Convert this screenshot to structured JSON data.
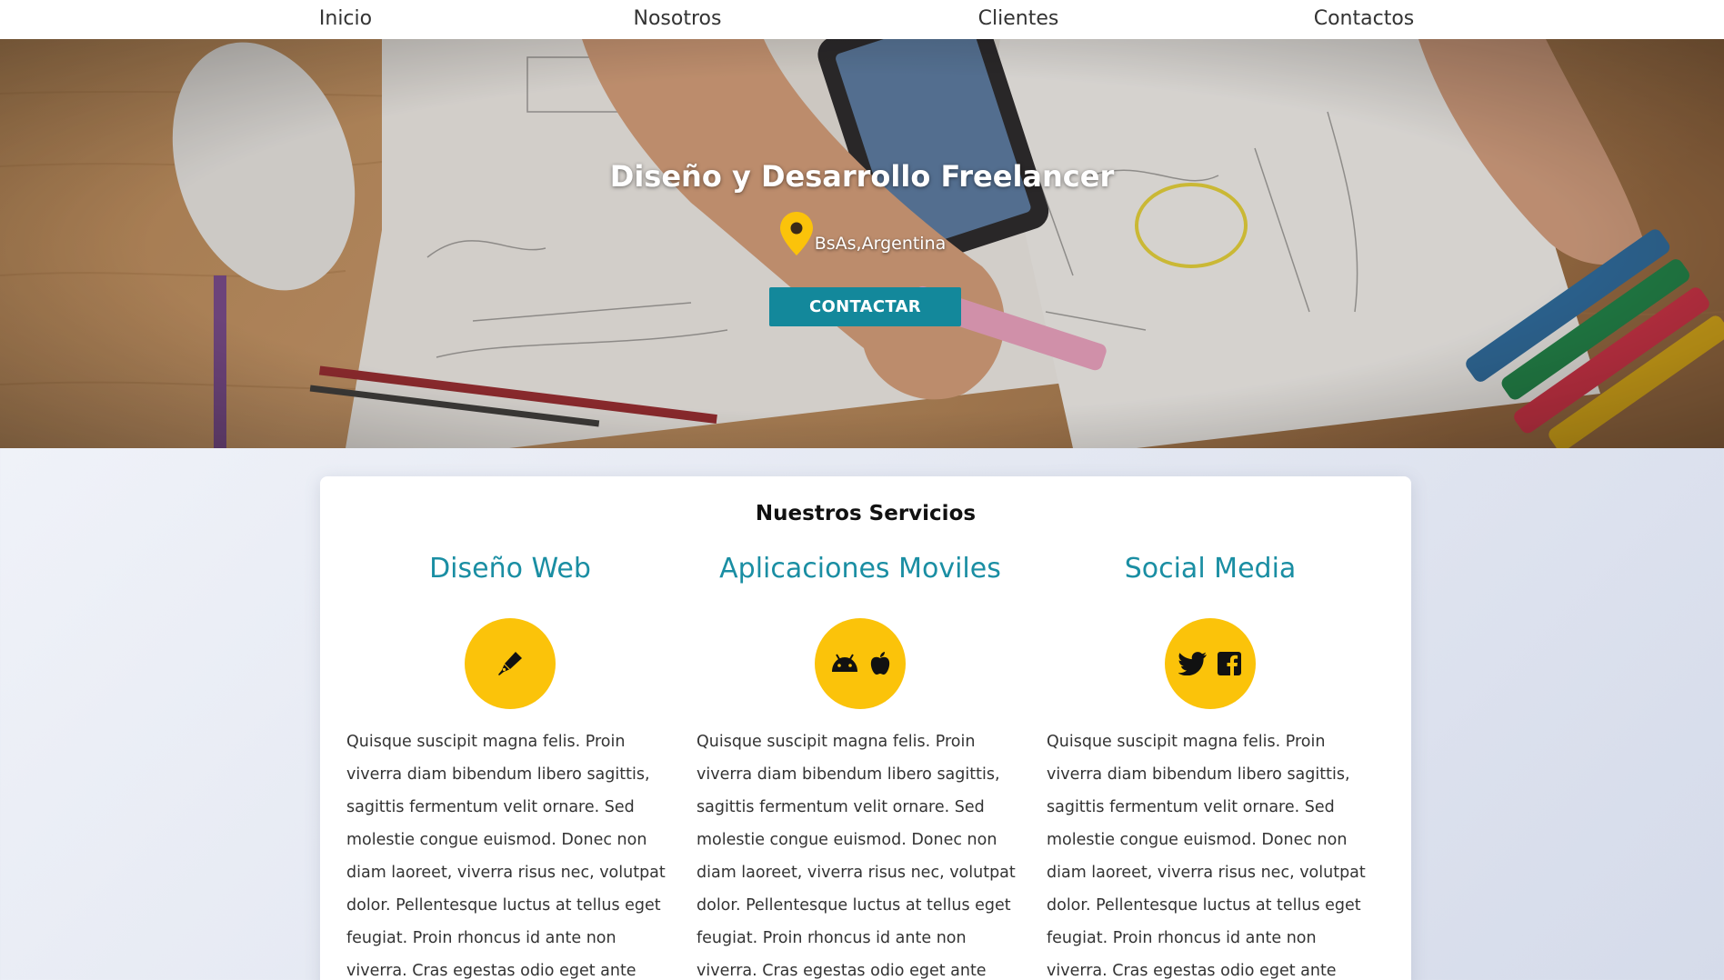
{
  "nav": {
    "items": [
      {
        "label": "Inicio"
      },
      {
        "label": "Nosotros"
      },
      {
        "label": "Clientes"
      },
      {
        "label": "Contactos"
      }
    ]
  },
  "hero": {
    "title": "Diseño y Desarrollo Freelancer",
    "location": "BsAs,Argentina",
    "cta_label": "CONTACTAR",
    "icon": "map-pin-icon"
  },
  "services": {
    "title": "Nuestros Servicios",
    "items": [
      {
        "heading": "Diseño Web",
        "icons": [
          "pen-nib-icon"
        ],
        "text": "Quisque suscipit magna felis. Proin viverra diam bibendum libero sagittis, sagittis fermentum velit ornare. Sed molestie congue euismod. Donec non diam laoreet, viverra risus nec, volutpat dolor. Pellentesque luctus at tellus eget feugiat. Proin rhoncus id ante non viverra. Cras egestas odio eget ante convallis blandit."
      },
      {
        "heading": "Aplicaciones Moviles",
        "icons": [
          "android-icon",
          "apple-icon"
        ],
        "text": "Quisque suscipit magna felis. Proin viverra diam bibendum libero sagittis, sagittis fermentum velit ornare. Sed molestie congue euismod. Donec non diam laoreet, viverra risus nec, volutpat dolor. Pellentesque luctus at tellus eget feugiat. Proin rhoncus id ante non viverra. Cras egestas odio eget ante convallis blandit."
      },
      {
        "heading": "Social Media",
        "icons": [
          "twitter-icon",
          "facebook-icon"
        ],
        "text": "Quisque suscipit magna felis. Proin viverra diam bibendum libero sagittis, sagittis fermentum velit ornare. Sed molestie congue euismod. Donec non diam laoreet, viverra risus nec, volutpat dolor. Pellentesque luctus at tellus eget feugiat. Proin rhoncus id ante non viverra. Cras egestas odio eget ante convallis blandit."
      }
    ]
  },
  "colors": {
    "accent_teal": "#13889b",
    "heading_teal": "#1a8ea3",
    "icon_yellow": "#fbc30a",
    "nav_background": "#ffffff"
  }
}
